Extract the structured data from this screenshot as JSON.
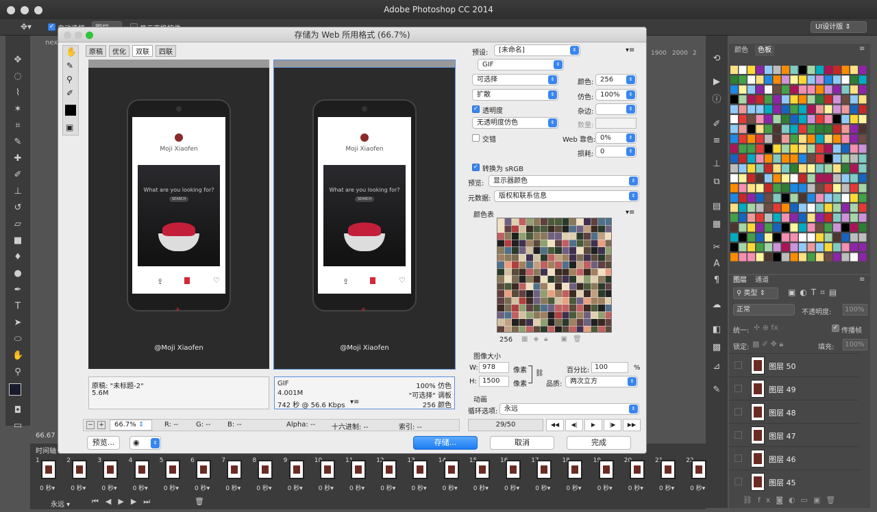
{
  "app": {
    "title": "Adobe Photoshop CC 2014"
  },
  "options_bar": {
    "tool_label": "自动选择:",
    "tool_target": "图层",
    "transform_label": "显示变换控件",
    "workspace": "UI设计版",
    "doc_tab_partial": "nex",
    "ruler_1900": "1900",
    "ruler_2000": "2000",
    "ruler_2": "2",
    "zoom_partial": "66.67"
  },
  "swatches": {
    "tabs": [
      "颜色",
      "色板"
    ]
  },
  "layers": {
    "tabs": [
      "图层",
      "通道"
    ],
    "filter": "类型",
    "blend": "正常",
    "opacity_label": "不透明度:",
    "opacity": "100%",
    "unify_label": "统一:",
    "propagate_label": "传播帧",
    "lock_label": "锁定:",
    "fill_label": "填充:",
    "fill": "100%",
    "items": [
      "图层 50",
      "图层 49",
      "图层 48",
      "图层 47",
      "图层 46",
      "图层 45"
    ]
  },
  "timeline": {
    "label": "时间轴",
    "frames": [
      "1",
      "2",
      "3",
      "4",
      "5",
      "6",
      "7",
      "8",
      "9",
      "10",
      "11",
      "12",
      "13",
      "14",
      "15",
      "16",
      "17",
      "18",
      "19",
      "20",
      "21",
      "22"
    ],
    "frame_time": "0 秒▾",
    "loop": "永远"
  },
  "dialog": {
    "title": "存储为 Web 所用格式 (66.7%)",
    "view_tabs": [
      "原稿",
      "优化",
      "双联",
      "四联"
    ],
    "preview": {
      "name": "Moji Xiaofen",
      "search_text": "What are you looking for?",
      "search_btn": "SEARCH",
      "handle": "@Moji Xiaofen",
      "add": "+"
    },
    "left_info": {
      "l1": "原稿: \"未标题-2\"",
      "l2": "5.6M"
    },
    "right_info": {
      "l1": "GIF",
      "l2": "4.001M",
      "l3": "742 秒 @ 56.6 Kbps",
      "r1": "100% 仿色",
      "r2": "\"可选择\" 调板",
      "r3": "256 颜色"
    },
    "status": {
      "zoom": "66.7%",
      "r": "R: --",
      "g": "G: --",
      "b": "B: --",
      "alpha": "Alpha: --",
      "hex": "十六进制: --",
      "index": "索引: --"
    },
    "preview_btn": "预览...",
    "settings": {
      "preset_label": "预设:",
      "preset": "[未命名]",
      "format": "GIF",
      "reduction": "可选择",
      "colors_label": "颜色:",
      "colors": "256",
      "dither_algo": "扩散",
      "dither_label": "仿色:",
      "dither": "100%",
      "transparency": "透明度",
      "matte_label": "杂边:",
      "trans_dither": "无透明度仿色",
      "amount_label": "数量:",
      "interlace": "交错",
      "websnap_label": "Web 靠色:",
      "websnap": "0%",
      "lossy_label": "损耗:",
      "lossy": "0",
      "srgb": "转换为 sRGB",
      "preview_label": "预览:",
      "preview_val": "显示器颜色",
      "meta_label": "元数据:",
      "meta_val": "版权和联系信息",
      "color_table_label": "颜色表",
      "ct_count": "256",
      "image_size_label": "图像大小",
      "w_label": "W:",
      "w": "978",
      "h_label": "H:",
      "h": "1500",
      "unit": "像素",
      "percent_label": "百分比:",
      "percent": "100",
      "pct": "%",
      "quality_label": "品质:",
      "quality": "两次立方",
      "anim_label": "动画",
      "loop_label": "循环选项:",
      "loop": "永远",
      "frame_counter": "29/50"
    },
    "buttons": {
      "save": "存储...",
      "cancel": "取消",
      "done": "完成"
    }
  }
}
